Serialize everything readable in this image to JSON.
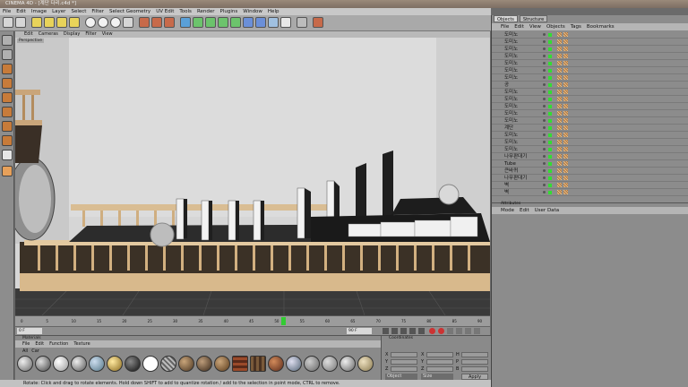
{
  "window": {
    "title": "CINEMA 4D - [계단 다리.c4d *]"
  },
  "menubar": [
    "File",
    "Edit",
    "Image",
    "Layer",
    "Select",
    "Filter",
    "Select Geometry",
    "UV Edit",
    "Tools",
    "Render",
    "Plugins",
    "Window",
    "Help"
  ],
  "viewport": {
    "menu": [
      "Edit",
      "Cameras",
      "Display",
      "Filter",
      "View"
    ],
    "label": "Perspective"
  },
  "timeline": {
    "ticks": [
      "0",
      "5",
      "10",
      "15",
      "20",
      "25",
      "30",
      "35",
      "40",
      "45",
      "50",
      "55",
      "60",
      "65",
      "70",
      "75",
      "80",
      "85",
      "90"
    ]
  },
  "playback": {
    "frame_field": "0 F",
    "end_field": "90 F"
  },
  "materials": {
    "menu": [
      "File",
      "Edit",
      "Function",
      "Texture"
    ],
    "tabs": [
      "All",
      "Car"
    ],
    "title": "Materials"
  },
  "coords": {
    "title": "Coordinates",
    "labels": [
      "X",
      "Y",
      "Z"
    ],
    "col2": [
      "X",
      "Y",
      "Z"
    ],
    "col3": [
      "H",
      "P",
      "B"
    ],
    "dropdown1": "Object",
    "dropdown2": "Size",
    "apply": "Apply"
  },
  "statusbar": {
    "text": "Rotate: Click and drag to rotate elements. Hold down SHIFT to add to quantize rotation / add to the selection in point mode, CTRL to remove."
  },
  "objects_panel": {
    "tabs": [
      "Objects",
      "Structure"
    ],
    "menu": [
      "File",
      "Edit",
      "View",
      "Objects",
      "Tags",
      "Bookmarks"
    ],
    "rows": [
      {
        "name": "도미노"
      },
      {
        "name": "도미노"
      },
      {
        "name": "도미노"
      },
      {
        "name": "도미노"
      },
      {
        "name": "도미노"
      },
      {
        "name": "도미노"
      },
      {
        "name": "도미노"
      },
      {
        "name": "공"
      },
      {
        "name": "도미노"
      },
      {
        "name": "도미노"
      },
      {
        "name": "도미노"
      },
      {
        "name": "도미노"
      },
      {
        "name": "도미노"
      },
      {
        "name": "계단"
      },
      {
        "name": "도미노"
      },
      {
        "name": "도미노"
      },
      {
        "name": "도미노"
      },
      {
        "name": "나무판대기"
      },
      {
        "name": "Tube"
      },
      {
        "name": "큰바퀴"
      },
      {
        "name": "나무판대기"
      },
      {
        "name": "벽"
      },
      {
        "name": "벽"
      }
    ]
  },
  "attributes_panel": {
    "title": "Attributes",
    "menu": [
      "Mode",
      "Edit",
      "User Data"
    ]
  },
  "colors": {
    "accent": "#c77b3a",
    "viewport_bg": "#d4d4d4",
    "panel": "#8c8c8c"
  }
}
